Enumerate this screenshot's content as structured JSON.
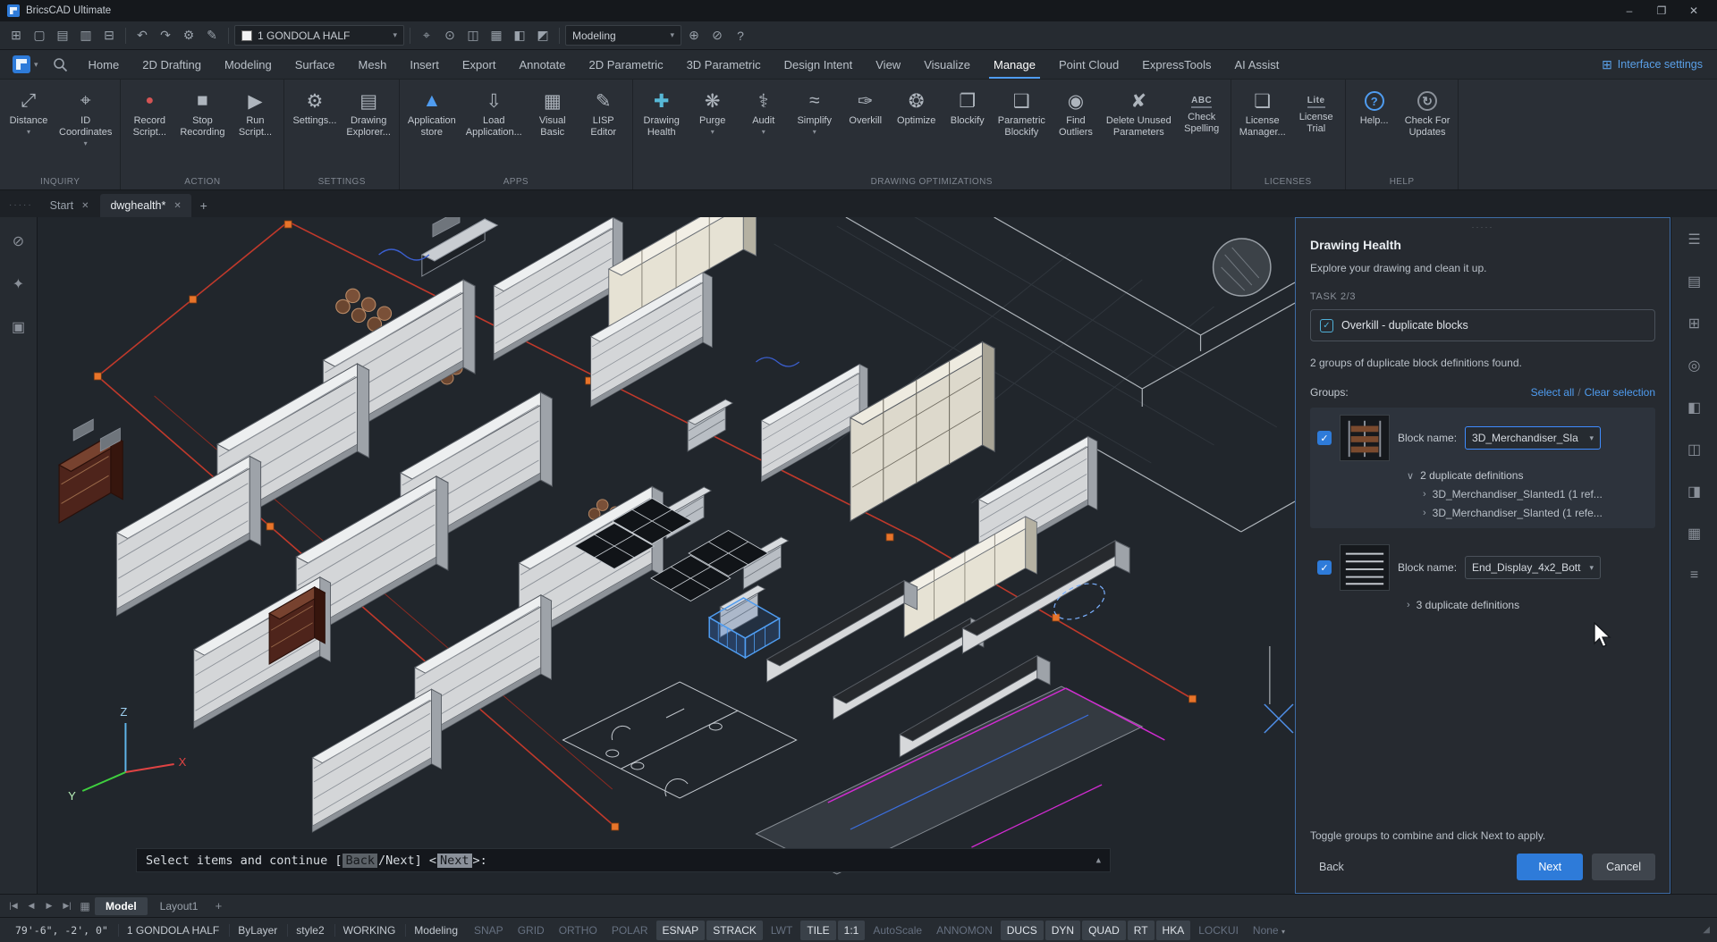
{
  "window": {
    "title": "BricsCAD Ultimate"
  },
  "icons": {
    "minimize": "–",
    "maximize": "❐",
    "close": "✕",
    "caret_down": "▾",
    "chevron_down": "∨",
    "chevron_right": "›",
    "handle_dots": "·····",
    "cmd_expand": "▲",
    "check": "✓",
    "add": "+",
    "grid": "⊞",
    "grip": "◢"
  },
  "quick_access": {
    "buttons_a": [
      {
        "name": "workspace-grid-icon",
        "glyph": "⊞"
      },
      {
        "name": "new-file-icon",
        "glyph": "▢"
      },
      {
        "name": "open-file-icon",
        "glyph": "▤"
      },
      {
        "name": "save-file-icon",
        "glyph": "▥"
      },
      {
        "name": "print-icon",
        "glyph": "⊟"
      },
      {
        "name": "undo-icon",
        "glyph": "↶"
      },
      {
        "name": "redo-icon",
        "glyph": "↷"
      },
      {
        "name": "settings-icon",
        "glyph": "⚙"
      },
      {
        "name": "annotate-icon",
        "glyph": "✎"
      }
    ],
    "layer_selector": "1 GONDOLA HALF",
    "buttons_b": [
      {
        "name": "crosshair-icon",
        "glyph": "⌖"
      },
      {
        "name": "entity-snap-icon",
        "glyph": "⊙"
      },
      {
        "name": "views-icon",
        "glyph": "◫"
      },
      {
        "name": "sheets-icon",
        "glyph": "▦"
      },
      {
        "name": "shade-icon",
        "glyph": "◧"
      },
      {
        "name": "ucs-icon",
        "glyph": "◩"
      }
    ],
    "workspace_selector": "Modeling",
    "buttons_c": [
      {
        "name": "pan-icon",
        "glyph": "⊕"
      },
      {
        "name": "orbit-icon",
        "glyph": "⊘"
      },
      {
        "name": "help-icon",
        "glyph": "?"
      }
    ]
  },
  "ribbon": {
    "tabs": [
      {
        "label": "Home"
      },
      {
        "label": "2D Drafting"
      },
      {
        "label": "Modeling"
      },
      {
        "label": "Surface"
      },
      {
        "label": "Mesh"
      },
      {
        "label": "Insert"
      },
      {
        "label": "Export"
      },
      {
        "label": "Annotate"
      },
      {
        "label": "2D Parametric"
      },
      {
        "label": "3D Parametric"
      },
      {
        "label": "Design Intent"
      },
      {
        "label": "View"
      },
      {
        "label": "Visualize"
      },
      {
        "label": "Manage"
      },
      {
        "label": "Point Cloud"
      },
      {
        "label": "ExpressTools"
      },
      {
        "label": "AI Assist"
      }
    ],
    "interface_settings": "Interface settings",
    "groups": [
      {
        "label": "INQUIRY",
        "items": [
          {
            "label": "Distance",
            "icon": "⤢"
          },
          {
            "label": "ID\nCoordinates",
            "icon": "⌖"
          }
        ]
      },
      {
        "label": "ACTION",
        "items": [
          {
            "label": "Record\nScript...",
            "icon": "●"
          },
          {
            "label": "Stop\nRecording",
            "icon": "■"
          },
          {
            "label": "Run\nScript...",
            "icon": "▶"
          }
        ]
      },
      {
        "label": "SETTINGS",
        "items": [
          {
            "label": "Settings...",
            "icon": "⚙"
          },
          {
            "label": "Drawing\nExplorer...",
            "icon": "▤"
          }
        ]
      },
      {
        "label": "APPS",
        "items": [
          {
            "label": "Application\nstore",
            "icon": "▲"
          },
          {
            "label": "Load\nApplication...",
            "icon": "⇩"
          },
          {
            "label": "Visual\nBasic",
            "icon": "▦"
          },
          {
            "label": "LISP\nEditor",
            "icon": "✎"
          }
        ]
      },
      {
        "label": "DRAWING OPTIMIZATIONS",
        "items": [
          {
            "label": "Drawing\nHealth",
            "icon": "✚"
          },
          {
            "label": "Purge",
            "icon": "❋"
          },
          {
            "label": "Audit",
            "icon": "⚕"
          },
          {
            "label": "Simplify",
            "icon": "≈"
          },
          {
            "label": "Overkill",
            "icon": "✑"
          },
          {
            "label": "Optimize",
            "icon": "❂"
          },
          {
            "label": "Blockify",
            "icon": "❐"
          },
          {
            "label": "Parametric\nBlockify",
            "icon": "❑"
          },
          {
            "label": "Find\nOutliers",
            "icon": "◉"
          },
          {
            "label": "Delete Unused\nParameters",
            "icon": "✘"
          },
          {
            "label": "Check\nSpelling",
            "icon": "ABC"
          }
        ]
      },
      {
        "label": "LICENSES",
        "items": [
          {
            "label": "License\nManager...",
            "icon": "❏"
          },
          {
            "label": "License\nTrial",
            "icon": "Lite"
          }
        ]
      },
      {
        "label": "HELP",
        "items": [
          {
            "label": "Help...",
            "icon": "?"
          },
          {
            "label": "Check For\nUpdates",
            "icon": "↻"
          }
        ]
      }
    ]
  },
  "document_tabs": {
    "tabs": [
      {
        "label": "Start"
      },
      {
        "label": "dwghealth*"
      }
    ]
  },
  "left_strip": [
    {
      "name": "visibility-icon",
      "glyph": "⊘"
    },
    {
      "name": "tips-icon",
      "glyph": "✦"
    },
    {
      "name": "blocks-stack-icon",
      "glyph": "▣"
    }
  ],
  "right_strip": [
    {
      "name": "panels-tune-icon",
      "glyph": "☰"
    },
    {
      "name": "layers-panel-icon",
      "glyph": "▤"
    },
    {
      "name": "blocks-panel-icon",
      "glyph": "⊞"
    },
    {
      "name": "attachments-panel-icon",
      "glyph": "◎"
    },
    {
      "name": "render-panel-icon",
      "glyph": "◧"
    },
    {
      "name": "display-panel-icon",
      "glyph": "◫"
    },
    {
      "name": "tags-panel-icon",
      "glyph": "◨"
    },
    {
      "name": "sheets-panel-icon",
      "glyph": "▦"
    },
    {
      "name": "structure-panel-icon",
      "glyph": "≡"
    }
  ],
  "viewport": {
    "ucs": {
      "x": "X",
      "y": "Y",
      "z": "Z"
    }
  },
  "command_line": {
    "prefix": "Select items and continue [",
    "kw_back": "Back",
    "slash": "/",
    "kw_next": "Next",
    "mid": "] <",
    "kw_next2": "Next",
    "suffix": ">:"
  },
  "panel": {
    "title": "Drawing Health",
    "subtitle": "Explore your drawing and clean it up.",
    "task_label": "TASK 2/3",
    "task_item": "Overkill - duplicate blocks",
    "summary": "2 groups of duplicate block definitions found.",
    "groups_label": "Groups:",
    "select_all": "Select all",
    "separator": "/",
    "clear_selection": "Clear selection",
    "block_name_label": "Block name:",
    "groups": [
      {
        "block_name": "3D_Merchandiser_Sla",
        "duplicates": "2 duplicate definitions",
        "children": [
          "3D_Merchandiser_Slanted1 (1 ref...",
          "3D_Merchandiser_Slanted (1 refe..."
        ]
      },
      {
        "block_name": "End_Display_4x2_Bott",
        "duplicates": "3 duplicate definitions",
        "children": []
      }
    ],
    "hint": "Toggle groups to combine and click Next to apply.",
    "back": "Back",
    "next": "Next",
    "cancel": "Cancel"
  },
  "layout_bar": {
    "nav": [
      "|◀",
      "◀",
      "▶",
      "▶|"
    ],
    "sheet_icon": "▦",
    "tabs": [
      {
        "label": "Model"
      },
      {
        "label": "Layout1"
      }
    ],
    "add": "+"
  },
  "status_bar": {
    "coordinates": "79'-6\", -2', 0\"",
    "fields": [
      "1 GONDOLA HALF",
      "ByLayer",
      "style2",
      "WORKING",
      "Modeling"
    ],
    "toggles": [
      {
        "label": "SNAP"
      },
      {
        "label": "GRID"
      },
      {
        "label": "ORTHO"
      },
      {
        "label": "POLAR"
      },
      {
        "label": "ESNAP"
      },
      {
        "label": "STRACK"
      },
      {
        "label": "LWT"
      },
      {
        "label": "TILE"
      },
      {
        "label": "1:1"
      },
      {
        "label": "AutoScale"
      },
      {
        "label": "ANNOMON"
      },
      {
        "label": "DUCS"
      },
      {
        "label": "DYN"
      },
      {
        "label": "QUAD"
      },
      {
        "label": "RT"
      },
      {
        "label": "HKA"
      },
      {
        "label": "LOCKUI"
      },
      {
        "label": "None"
      }
    ]
  },
  "colors": {
    "accent": "#4f9cf0",
    "button": "#2e7bd9",
    "selection": "#3f8cff",
    "boundary": "#c0392b",
    "grip": "#e8742a"
  }
}
